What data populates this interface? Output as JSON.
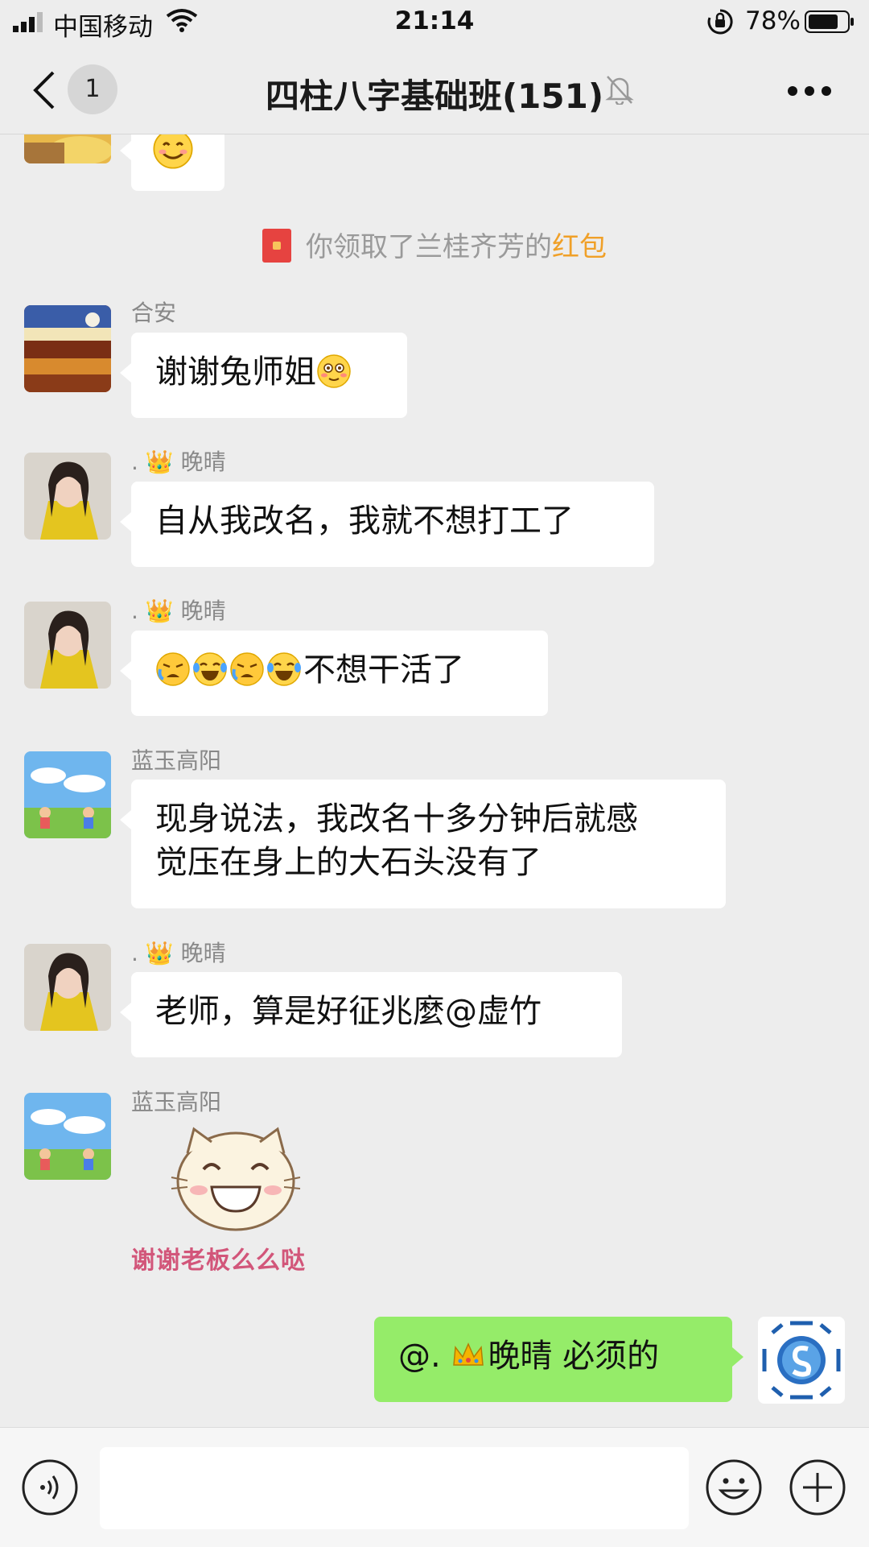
{
  "status_bar": {
    "carrier": "中国移动",
    "time": "21:14",
    "battery": "78%"
  },
  "header": {
    "unread_count": "1",
    "title": "四柱八字基础班(151)"
  },
  "messages": {
    "top_partial": {
      "emoji": "smiling-face-emoji"
    },
    "system": {
      "prefix": "你领取了兰桂齐芳的",
      "highlight": "红包"
    },
    "m1": {
      "sender": "合安",
      "text": "谢谢兔师姐"
    },
    "m2": {
      "sender": ". 👑 晚晴",
      "text": "自从我改名，我就不想打工了"
    },
    "m3": {
      "sender": ". 👑 晚晴",
      "text": "不想干活了"
    },
    "m4": {
      "sender": "蓝玉高阳",
      "line1": "现身说法，我改名十多分钟后就感",
      "line2": "觉压在身上的大石头没有了"
    },
    "m5": {
      "sender": ". 👑 晚晴",
      "text": "老师，算是好征兆麼@虚竹"
    },
    "m6": {
      "sender": "蓝玉高阳",
      "sticker_caption": "谢谢老板么么哒"
    },
    "m7": {
      "prefix": "@. ",
      "name": "晚晴",
      "suffix": " 必须的"
    }
  },
  "input_bar": {
    "placeholder": ""
  },
  "colors": {
    "background": "#ededed",
    "my_bubble": "#95ec69",
    "highlight": "#f0a028"
  }
}
